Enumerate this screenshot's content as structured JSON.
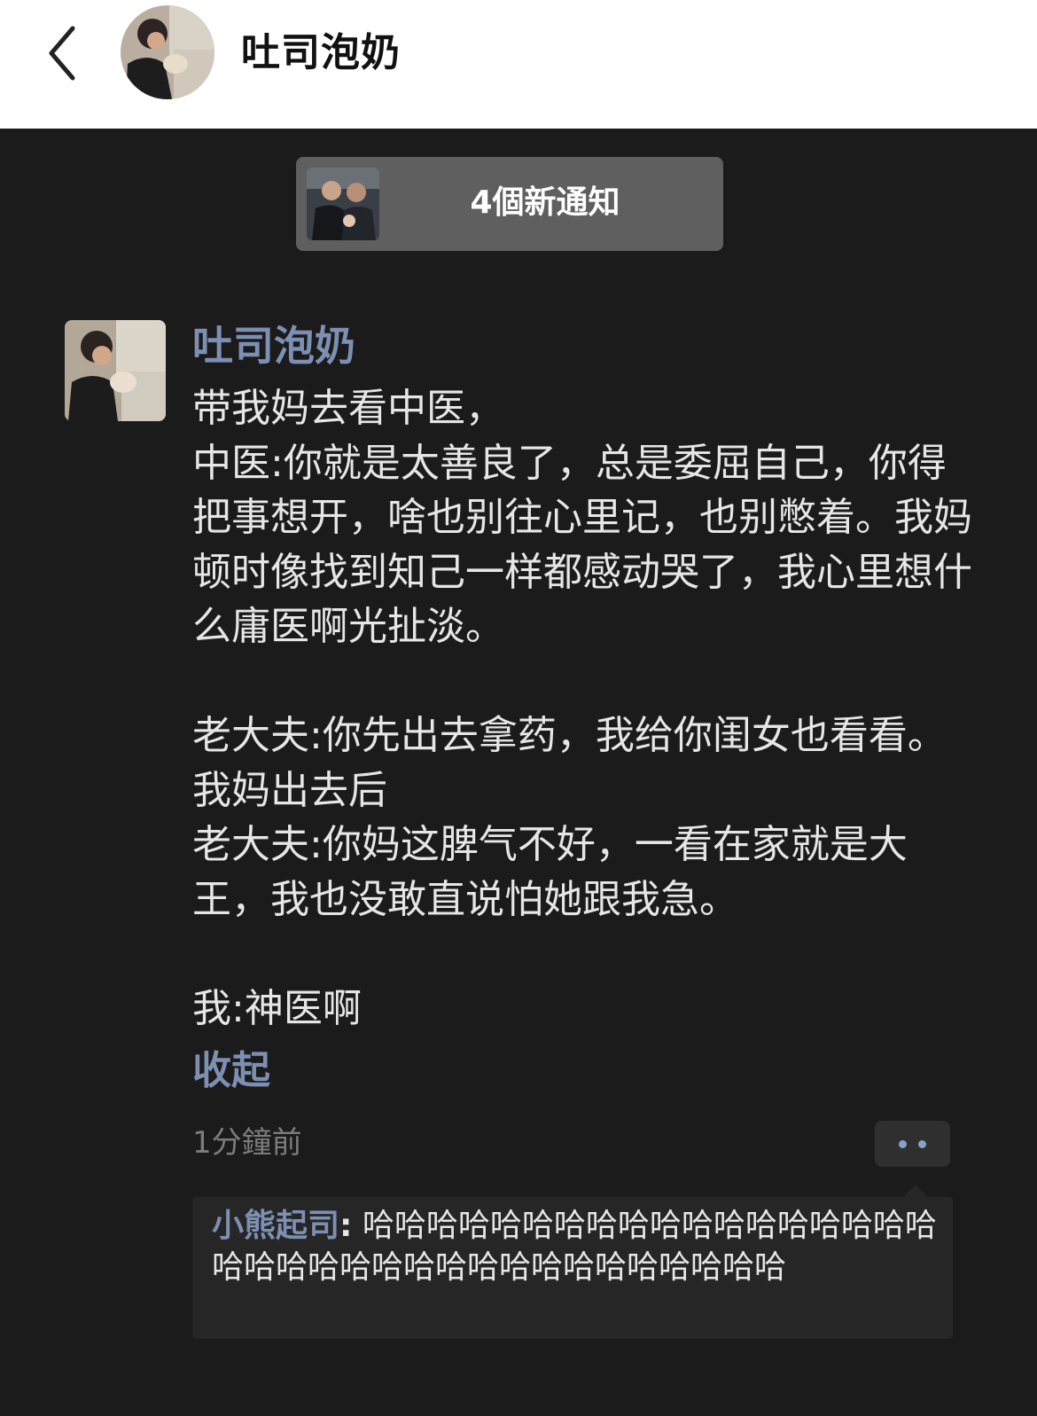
{
  "header": {
    "back_icon": "chevron-left-icon",
    "title": "吐司泡奶"
  },
  "notification": {
    "text": "4個新通知"
  },
  "post": {
    "author": "吐司泡奶",
    "paragraphs": [
      "带我妈去看中医，\n中医:你就是太善良了，总是委屈自己，你得把事想开，啥也别往心里记，也别憋着。我妈顿时像找到知己一样都感动哭了，我心里想什么庸医啊光扯淡。",
      "老大夫:你先出去拿药，我给你闺女也看看。我妈出去后\n老大夫:你妈这脾气不好，一看在家就是大王，我也没敢直说怕她跟我急。",
      "我:神医啊"
    ],
    "collapse_label": "收起",
    "timestamp": "1分鐘前",
    "more_icon": "more-dots-icon"
  },
  "comments": [
    {
      "author": "小熊起司",
      "separator": ":",
      "text": "哈哈哈哈哈哈哈哈哈哈哈哈哈哈哈哈哈哈哈哈哈哈哈哈哈哈哈哈哈哈哈哈哈哈哈哈"
    }
  ],
  "colors": {
    "background": "#1b1b1b",
    "header_bg": "#ffffff",
    "link_blue": "#7d90b3",
    "body_text": "#e6e6e6",
    "muted_text": "#7c7c7c",
    "notification_bg": "#5f5f5f"
  }
}
